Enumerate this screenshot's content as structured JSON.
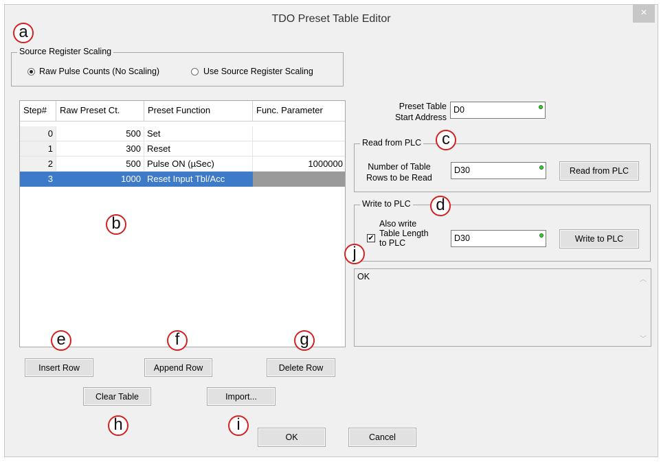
{
  "window": {
    "title": "TDO Preset Table Editor",
    "close_glyph": "×"
  },
  "scaling": {
    "legend": "Source Register Scaling",
    "options": [
      "Raw Pulse Counts (No Scaling)",
      "Use Source Register Scaling"
    ],
    "selected": "Raw Pulse Counts (No Scaling)"
  },
  "table": {
    "columns": [
      "Step#",
      "Raw Preset Ct.",
      "Preset Function",
      "Func. Parameter"
    ],
    "rows": [
      {
        "step": "0",
        "count": "500",
        "function": "Set",
        "param": ""
      },
      {
        "step": "1",
        "count": "300",
        "function": "Reset",
        "param": ""
      },
      {
        "step": "2",
        "count": "500",
        "function": "Pulse ON (µSec)",
        "param": "1000000"
      },
      {
        "step": "3",
        "count": "1000",
        "function": "Reset Input Tbl/Acc",
        "param": ""
      }
    ],
    "selected_step": "3"
  },
  "preset": {
    "label_line1": "Preset Table",
    "label_line2": "Start Address",
    "value": "D0"
  },
  "read": {
    "legend": "Read from PLC",
    "label_line1": "Number of Table",
    "label_line2": "Rows to be Read",
    "value": "D30",
    "button": "Read from PLC"
  },
  "write": {
    "legend": "Write to PLC",
    "check_line1": "Also write",
    "check_line2": "Table Length",
    "check_line3": "to PLC",
    "checked": true,
    "value": "D30",
    "button": "Write to PLC"
  },
  "log": {
    "text": "OK"
  },
  "buttons": {
    "insert": "Insert Row",
    "append": "Append Row",
    "delete": "Delete Row",
    "clear": "Clear Table",
    "import": "Import...",
    "ok": "OK",
    "cancel": "Cancel"
  },
  "callouts": [
    "a",
    "b",
    "c",
    "d",
    "e",
    "f",
    "g",
    "h",
    "i",
    "j"
  ],
  "colors": {
    "selection": "#3d7ac7",
    "callout_border": "#d32020",
    "indicator": "#36d036"
  }
}
